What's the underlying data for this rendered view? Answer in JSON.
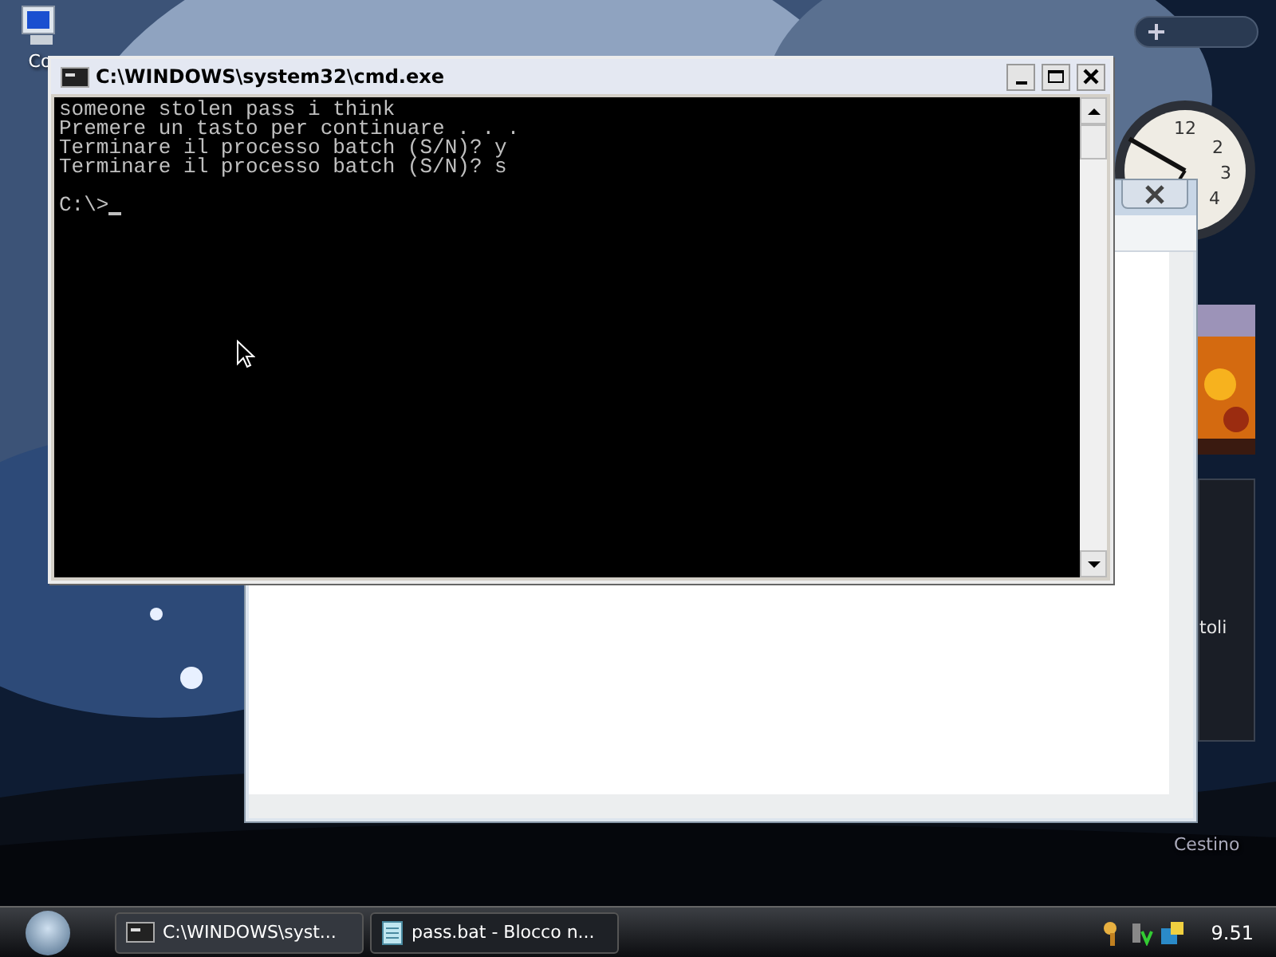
{
  "desktop": {
    "icons": [
      {
        "label": "Co",
        "kind": "computer"
      },
      {
        "label": "Cestino",
        "kind": "bin"
      }
    ]
  },
  "sidebar": {
    "gadget_text": "toli",
    "clock_numerals": [
      "12",
      "2",
      "3",
      "4"
    ]
  },
  "cmd_window": {
    "title": "C:\\WINDOWS\\system32\\cmd.exe",
    "lines": [
      "someone stolen pass i think",
      "Premere un tasto per continuare . . .",
      "Terminare il processo batch (S/N)? y",
      "Terminare il processo batch (S/N)? s"
    ],
    "prompt": "C:\\>"
  },
  "taskbar": {
    "tasks": [
      {
        "label": "C:\\WINDOWS\\syst...",
        "kind": "cmd",
        "selected": true
      },
      {
        "label": "pass.bat - Blocco n...",
        "kind": "notepad",
        "selected": false
      }
    ],
    "clock": "9.51"
  }
}
